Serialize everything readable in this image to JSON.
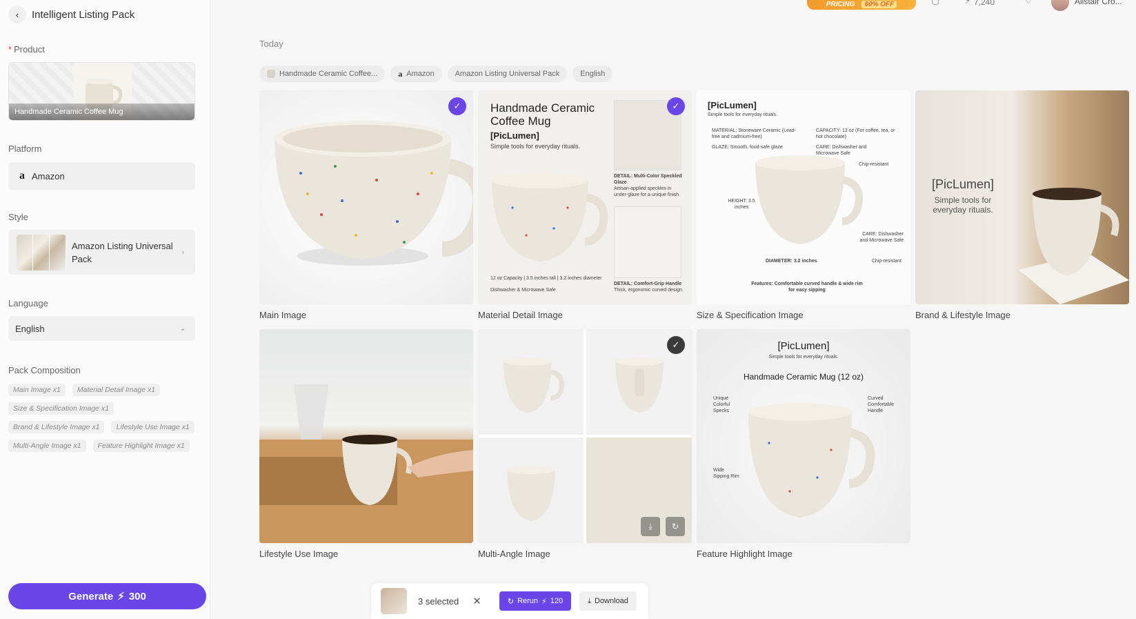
{
  "sidebar": {
    "title": "Intelligent Listing Pack",
    "product": {
      "label": "Product",
      "name": "Handmade Ceramic Coffee Mug"
    },
    "platform": {
      "label": "Platform",
      "value": "Amazon",
      "logo": "a"
    },
    "style": {
      "label": "Style",
      "value": "Amazon Listing Universal Pack"
    },
    "language": {
      "label": "Language",
      "value": "English"
    },
    "composition": {
      "label": "Pack Composition",
      "items": [
        "Main Image x1",
        "Material Detail Image x1",
        "Size & Specification Image x1",
        "Brand & Lifestyle Image x1",
        "Lifestyle Use Image x1",
        "Multi-Angle Image x1",
        "Feature Highlight Image x1"
      ]
    },
    "generate": {
      "label": "Generate",
      "cost": "300"
    }
  },
  "topbar": {
    "pricing": "PRICING",
    "discount": "60% OFF",
    "credits": "7,240",
    "username": "Alistair Cro..."
  },
  "main": {
    "date_group": "Today",
    "tags": [
      "Handmade Ceramic Coffee...",
      "Amazon",
      "Amazon Listing Universal Pack",
      "English"
    ],
    "images": [
      {
        "caption": "Main Image",
        "selected": true
      },
      {
        "caption": "Material Detail Image",
        "selected": true,
        "title": "Handmade Ceramic Coffee Mug",
        "brand": "[PicLumen]",
        "tagline": "Simple tools for everyday rituals.",
        "detail1_title": "DETAIL: Multi-Color Speckled Glaze",
        "detail1_body": "Artisan-applied speckles in under-glaze for a unique finish.",
        "specs": "12 oz Capacity | 3.5 inches tall | 3.2 inches diameter",
        "washer": "Dishwasher & Microwave Safe",
        "detail2_title": "DETAIL: Comfort-Grip Handle",
        "detail2_body": "Thick, ergonomic curved design."
      },
      {
        "caption": "Size & Specification Image",
        "selected": false,
        "brand": "[PicLumen]",
        "tagline": "Simple tools for everyday rituals.",
        "material": "MATERIAL: Stoneware Ceramic (Lead-free and cadmium-free)",
        "glaze": "GLAZE: Smooth, food-safe glaze",
        "capacity": "CAPACITY: 12 oz (For coffee, tea, or hot chocolate)",
        "care_top": "CARE: Dishwasher and Microwave Safe",
        "chip_top": "Chip-resistant",
        "height": "HEIGHT: 3.5 inches",
        "care_bottom": "CARE: Dishwasher and Microwave Safe",
        "chip_bottom": "Chip-resistant",
        "diameter": "DIAMETER: 3.2 inches",
        "features": "Features: Comfortable curved handle & wide rim for easy sipping"
      },
      {
        "caption": "Brand & Lifestyle Image",
        "selected": false,
        "brand": "[PicLumen]",
        "tagline": "Simple tools for everyday rituals."
      },
      {
        "caption": "Lifestyle Use Image",
        "selected": false
      },
      {
        "caption": "Multi-Angle Image",
        "selected": true
      },
      {
        "caption": "Feature Highlight Image",
        "selected": false,
        "brand": "[PicLumen]",
        "tagline": "Simple tools for everyday rituals.",
        "title": "Handmade Ceramic Mug (12 oz)",
        "callout1": "Unique Colorful Specks",
        "callout2": "Curved Comfortable Handle",
        "callout3": "Wide Sipping Rim"
      }
    ]
  },
  "actionbar": {
    "selected": "3 selected",
    "rerun": "Rerun",
    "rerun_cost": "120",
    "download": "Download"
  },
  "colors": {
    "accent": "#6a45e8",
    "pricing": "#f39a2b"
  }
}
